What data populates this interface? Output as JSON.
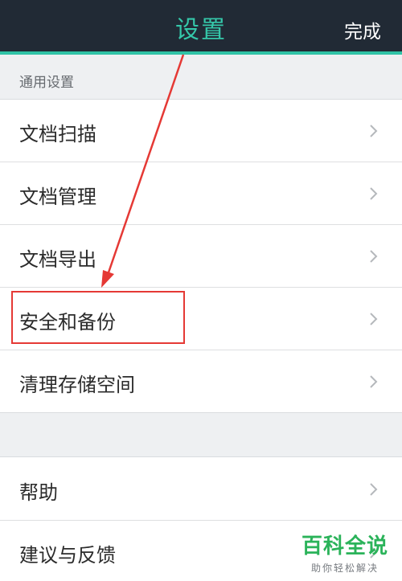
{
  "header": {
    "title": "设置",
    "done_label": "完成"
  },
  "section": {
    "label": "通用设置"
  },
  "items": [
    {
      "label": "文档扫描"
    },
    {
      "label": "文档管理"
    },
    {
      "label": "文档导出"
    },
    {
      "label": "安全和备份"
    },
    {
      "label": "清理存储空间"
    }
  ],
  "items2": [
    {
      "label": "帮助"
    },
    {
      "label": "建议与反馈"
    }
  ],
  "icons": {
    "row_chevron": "chevron-right-icon"
  },
  "colors": {
    "header_bg": "#212a35",
    "accent": "#35c8aa",
    "highlight": "#e53935"
  },
  "watermark": {
    "main": "百科全说",
    "sub": "助你轻松解决"
  }
}
